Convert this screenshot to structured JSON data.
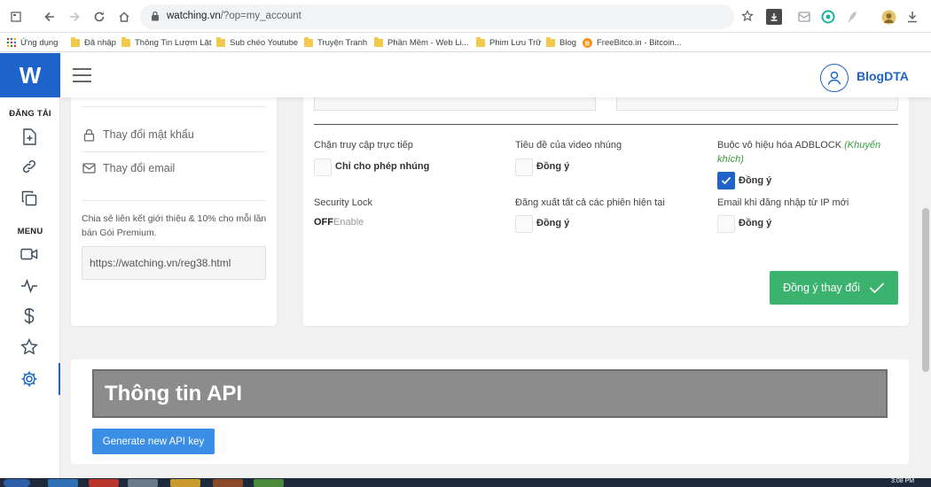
{
  "browser": {
    "url_host": "watching.vn",
    "url_path": "/?op=my_account",
    "bookmarks": [
      {
        "label": "Ứng dụng",
        "icon": "apps-icon"
      },
      {
        "label": "Đã nhập",
        "icon": "folder-icon"
      },
      {
        "label": "Thông Tin Lượm Lặt",
        "icon": "folder-icon"
      },
      {
        "label": "Sub chéo Youtube",
        "icon": "folder-icon"
      },
      {
        "label": "Truyện Tranh",
        "icon": "folder-icon"
      },
      {
        "label": "Phần Mềm - Web Li...",
        "icon": "folder-icon"
      },
      {
        "label": "Phim Lưu Trữ",
        "icon": "folder-icon"
      },
      {
        "label": "Blog",
        "icon": "folder-icon"
      },
      {
        "label": "FreeBitco.in - Bitcoin...",
        "icon": "bitcoin-icon"
      }
    ]
  },
  "site": {
    "logo": "W",
    "user_name": "BlogDTA"
  },
  "rail": {
    "upload_heading": "ĐĂNG TẢI",
    "menu_heading": "MENU"
  },
  "left_card": {
    "change_password": "Thay đổi mật khẩu",
    "change_email": "Thay đổi email",
    "referral_text": "Chia sẻ liên kết giới thiệu & 10% cho mỗi lần bán Gói Premium.",
    "referral_link": "https://watching.vn/reg38.html"
  },
  "settings": {
    "block_direct": {
      "label": "Chặn truy cập trực tiếp",
      "option": "Chỉ cho phép nhúng",
      "checked": false
    },
    "embed_title": {
      "label": "Tiêu đề của video nhúng",
      "option": "Đồng ý",
      "checked": false
    },
    "force_adblock": {
      "label": "Buộc vô hiệu hóa ADBLOCK",
      "note": "(Khuyến khích)",
      "option": "Đồng ý",
      "checked": true
    },
    "security_lock": {
      "label": "Security Lock",
      "state": "OFF",
      "action": "Enable"
    },
    "logout_all": {
      "label": "Đăng xuất tất cả các phiên hiện tại",
      "option": "Đồng ý",
      "checked": false
    },
    "email_new_ip": {
      "label": "Email khi đăng nhập từ IP mới",
      "option": "Đồng ý",
      "checked": false
    },
    "save_button": "Đồng ý thay đổi"
  },
  "api": {
    "title": "Thông tin API",
    "generate_button": "Generate new API key"
  },
  "taskbar": {
    "time": "3:08 PM"
  },
  "colors": {
    "brand": "#1d63c9",
    "success": "#3bb36f",
    "api_button": "#3a8ee6"
  }
}
